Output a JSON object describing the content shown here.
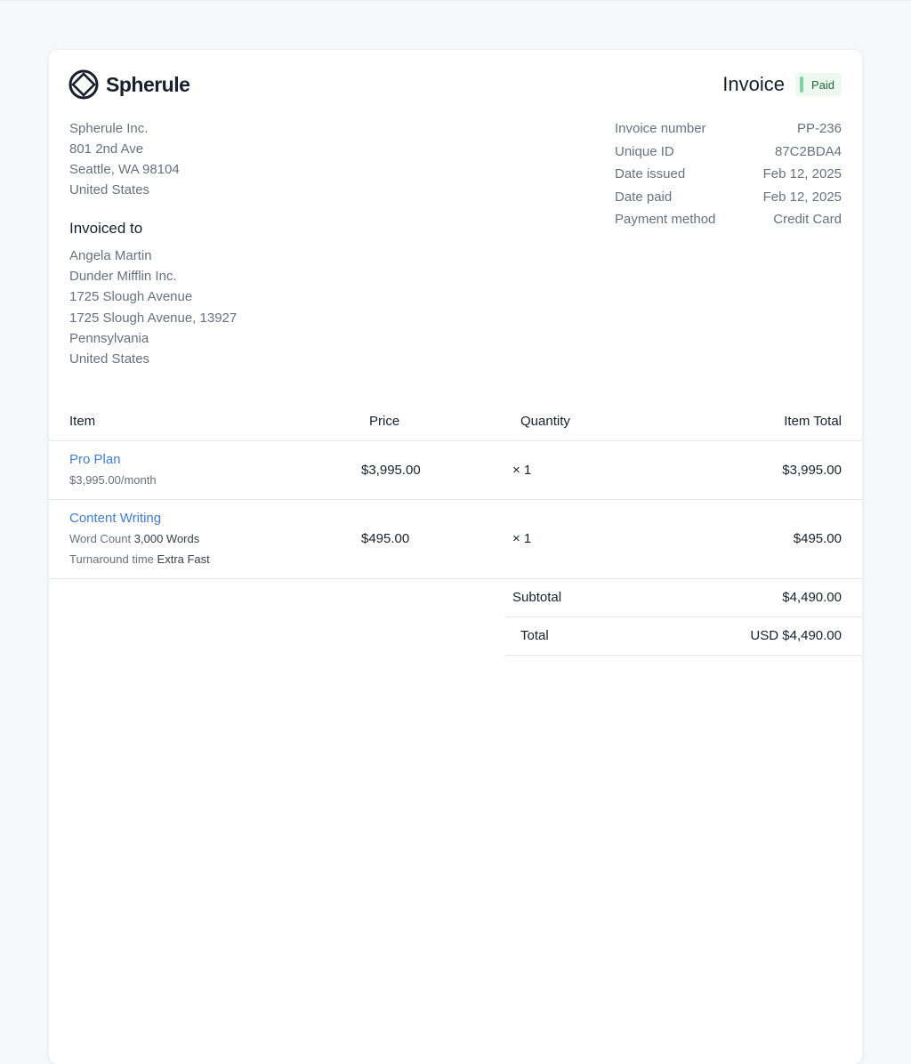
{
  "brand": {
    "name": "Spherule"
  },
  "invoice": {
    "title": "Invoice",
    "status": "Paid"
  },
  "from": [
    "Spherule Inc.",
    "801 2nd Ave",
    "Seattle, WA 98104",
    "United States"
  ],
  "invoiced_to": {
    "heading": "Invoiced to",
    "lines": [
      "Angela Martin",
      "Dunder Mifflin Inc.",
      "1725 Slough Avenue",
      "1725 Slough Avenue, 13927",
      "Pennsylvania",
      "United States"
    ]
  },
  "meta": [
    {
      "label": "Invoice number",
      "value": "PP-236"
    },
    {
      "label": "Unique ID",
      "value": "87C2BDA4"
    },
    {
      "label": "Date issued",
      "value": "Feb 12, 2025"
    },
    {
      "label": "Date paid",
      "value": "Feb 12, 2025"
    },
    {
      "label": "Payment method",
      "value": "Credit Card"
    }
  ],
  "table": {
    "headers": {
      "item": "Item",
      "price": "Price",
      "quantity": "Quantity",
      "total": "Item Total"
    },
    "rows": [
      {
        "name": "Pro Plan",
        "details": [
          {
            "label": "$3,995.00/month",
            "value": ""
          }
        ],
        "price": "$3,995.00",
        "quantity": "× 1",
        "total": "$3,995.00"
      },
      {
        "name": "Content Writing",
        "details": [
          {
            "label": "Word Count",
            "value": "3,000 Words"
          },
          {
            "label": "Turnaround time",
            "value": "Extra Fast"
          }
        ],
        "price": "$495.00",
        "quantity": "× 1",
        "total": "$495.00"
      }
    ]
  },
  "summary": {
    "subtotal_label": "Subtotal",
    "subtotal_value": "$4,490.00",
    "total_label": "Total",
    "total_value": "USD $4,490.00"
  },
  "colors": {
    "link": "#3f7fd8",
    "paid_badge": "#7ad69a",
    "paid_badge_bg": "#eef8f1"
  }
}
